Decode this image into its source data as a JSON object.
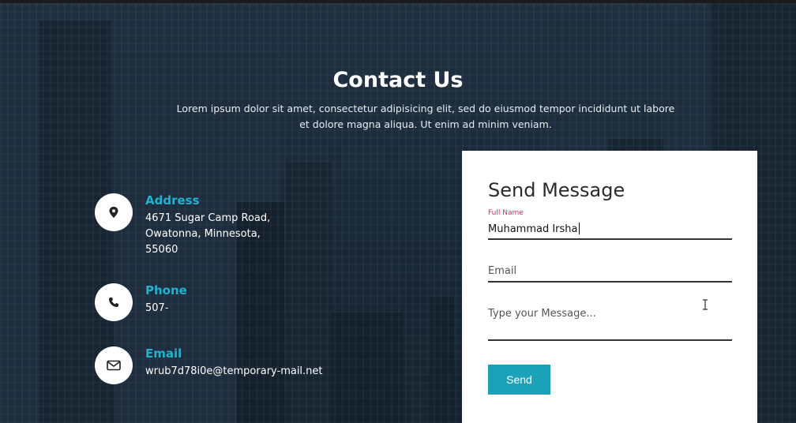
{
  "header": {
    "title": "Contact Us",
    "subtitle_line1": "Lorem ipsum dolor sit amet, consectetur adipisicing elit, sed do eiusmod tempor incididunt ut labore",
    "subtitle_line2": "et dolore magna aliqua. Ut enim ad minim veniam."
  },
  "contact_info": {
    "address": {
      "title": "Address",
      "line1": "4671 Sugar Camp Road,",
      "line2": "Owatonna, Minnesota,",
      "line3": "55060",
      "icon": "map-pin-icon"
    },
    "phone": {
      "title": "Phone",
      "value": "507-",
      "icon": "phone-icon"
    },
    "email": {
      "title": "Email",
      "value": "wrub7d78i0e@temporary-mail.net",
      "icon": "envelope-icon"
    }
  },
  "form": {
    "title": "Send Message",
    "full_name_label": "Full Name",
    "full_name_value": "Muhammad Irsha",
    "email_placeholder": "Email",
    "message_placeholder": "Type your Message...",
    "send_label": "Send"
  },
  "colors": {
    "accent": "#1db4cf",
    "button": "#1aa3b8",
    "label_active": "#e0245e"
  }
}
